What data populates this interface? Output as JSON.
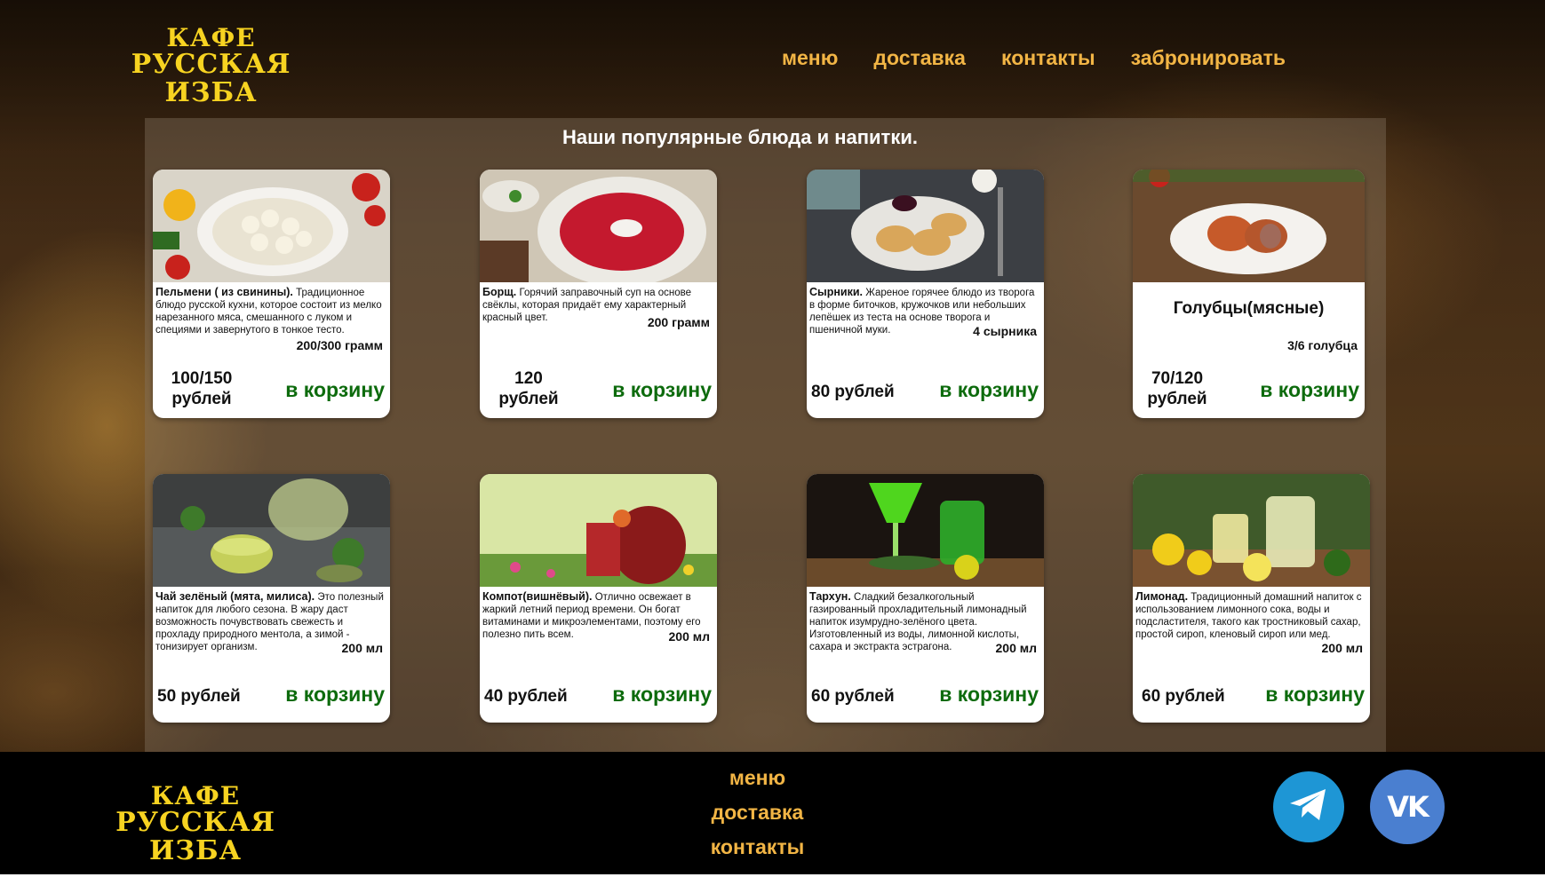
{
  "header": {
    "logo_line1": "КАФЕ",
    "logo_line2": "РУССКАЯ ИЗБА",
    "nav": [
      "меню",
      "доставка",
      "контакты",
      "забронировать"
    ]
  },
  "main": {
    "title": "Наши популярные блюда и напитки.",
    "cart_label": "в корзину",
    "cards": [
      {
        "name": "Пельмени ( из свинины).",
        "text": "Традиционное блюдо русской кухни, которое состоит из мелко нарезанного мяса, смешанного с луком и специями и завернутого в тонкое тесто.",
        "portion": "200/300 грамм",
        "price_line1": "100/150",
        "price_line2": "рублей"
      },
      {
        "name": "Борщ.",
        "text": "Горячий заправочный суп на основе свёклы, которая придаёт ему характерный красный цвет.",
        "portion": "200 грамм",
        "price_line1": "120",
        "price_line2": "рублей"
      },
      {
        "name": "Сырники.",
        "text": "Жареное горячее блюдо из творога в форме биточков, кружочков или небольших лепёшек из теста на основе творога и пшеничной муки.",
        "portion": "4 сырника",
        "price": "80 рублей"
      },
      {
        "name": "Голубцы(мясные)",
        "portion": "3/6 голубца",
        "price_line1": "70/120",
        "price_line2": "рублей"
      },
      {
        "name": "Чай зелёный (мята, милиса).",
        "text": "Это полезный напиток для любого сезона. В жару даст возможность почувствовать свежесть и прохладу природного ментола, а зимой - тонизирует организм.",
        "portion": "200 мл",
        "price": "50 рублей"
      },
      {
        "name": "Компот(вишнёвый).",
        "text": "Отлично освежает в жаркий летний период времени. Он богат витаминами и микроэлементами, поэтому его полезно пить всем.",
        "portion": "200 мл",
        "price": "40 рублей"
      },
      {
        "name": "Тархун.",
        "text": "Сладкий безалкогольный газированный прохладительный лимонадный напиток изумрудно-зелёного цвета. Изготовленный из воды, лимонной кислоты, сахара и экстракта эстрагона.",
        "portion": "200 мл",
        "price": "60 рублей"
      },
      {
        "name": "Лимонад.",
        "text": "Традиционный домашний напиток с использованием лимонного сока, воды и подсластителя, такого как тростниковый сахар, простой сироп, кленовый сироп или мед.",
        "portion": "200 мл",
        "price": "60 рублей"
      }
    ]
  },
  "footer": {
    "logo_line1": "КАФЕ",
    "logo_line2": "РУССКАЯ ИЗБА",
    "nav": [
      "меню",
      "доставка",
      "контакты"
    ],
    "social": [
      {
        "icon": "telegram-icon",
        "color": "#1e96d5"
      },
      {
        "icon": "vk-icon",
        "color": "#4a7fd0",
        "text": "VK"
      }
    ]
  },
  "colors": {
    "accent_nav": "#f2b545",
    "logo": "#f7d321",
    "cart_green": "#0d6b0d"
  }
}
